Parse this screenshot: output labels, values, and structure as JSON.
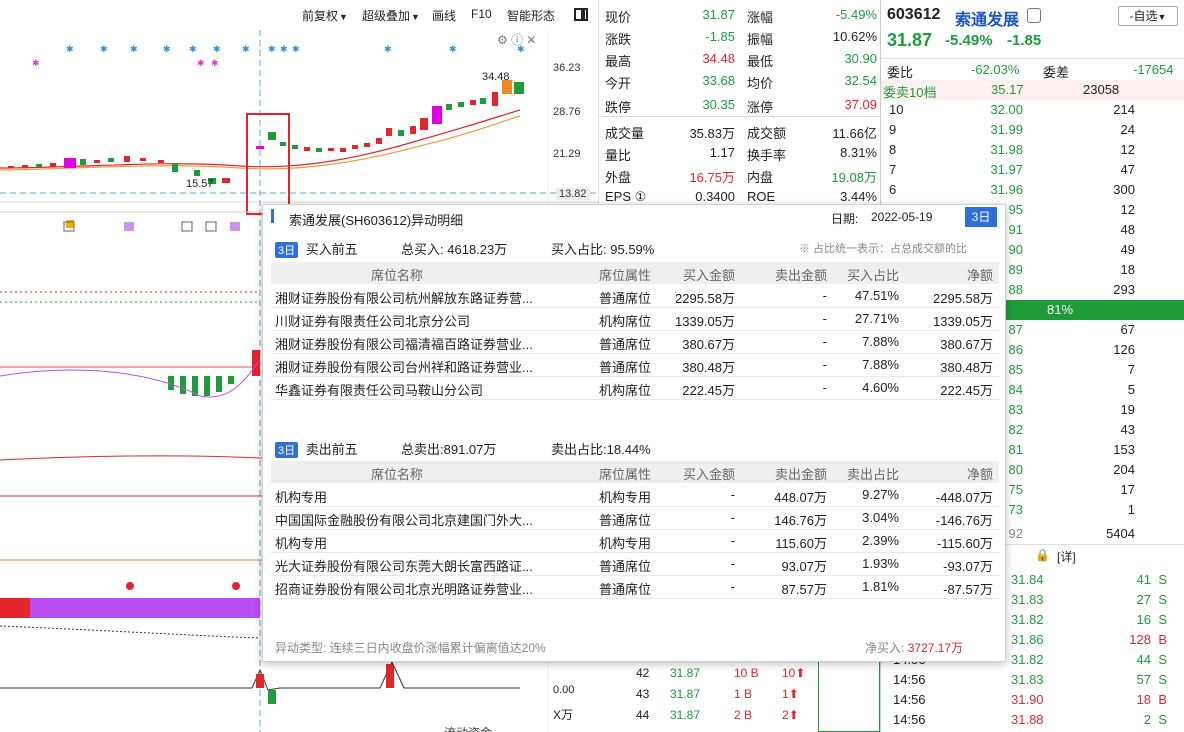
{
  "toolbar": {
    "items": [
      "前复权",
      "超级叠加",
      "画线",
      "F10",
      "智能形态"
    ]
  },
  "chart": {
    "price_ticks": [
      "36.23",
      "28.76",
      "21.29",
      "13.82"
    ],
    "high_label": "34.48",
    "low_label": "15.57",
    "lower_zero": "0.00",
    "unit_label": "X万",
    "bottom_label": "流动资金"
  },
  "quote": {
    "rows": [
      {
        "l1": "现价",
        "v1": "31.87",
        "c1": "green",
        "l2": "涨幅",
        "v2": "-5.49%",
        "c2": "green"
      },
      {
        "l1": "涨跌",
        "v1": "-1.85",
        "c1": "green",
        "l2": "振幅",
        "v2": "10.62%",
        "c2": "dark"
      },
      {
        "l1": "最高",
        "v1": "34.48",
        "c1": "red",
        "l2": "最低",
        "v2": "30.90",
        "c2": "green"
      },
      {
        "l1": "今开",
        "v1": "33.68",
        "c1": "green",
        "l2": "均价",
        "v2": "32.54",
        "c2": "green"
      },
      {
        "l1": "跌停",
        "v1": "30.35",
        "c1": "green",
        "l2": "涨停",
        "v2": "37.09",
        "c2": "red"
      },
      {
        "l1": "成交量",
        "v1": "35.83万",
        "c1": "dark",
        "l2": "成交额",
        "v2": "11.66亿",
        "c2": "dark"
      },
      {
        "l1": "量比",
        "v1": "1.17",
        "c1": "dark",
        "l2": "换手率",
        "v2": "8.31%",
        "c2": "dark"
      },
      {
        "l1": "外盘",
        "v1": "16.75万",
        "c1": "red",
        "l2": "内盘",
        "v2": "19.08万",
        "c2": "green"
      },
      {
        "l1": "EPS ①",
        "v1": "0.3400",
        "c1": "dark",
        "l2": "ROE",
        "v2": "3.44%",
        "c2": "dark"
      }
    ]
  },
  "stock": {
    "code": "603612",
    "name": "索通发展",
    "price": "31.87",
    "change_pct": "-5.49%",
    "change": "-1.85",
    "watch_button": "-自选",
    "ratio_label": "委比",
    "ratio": "-62.03%",
    "diff_label": "委差",
    "diff": "-17654",
    "sell10_label": "委卖10档",
    "sell10_price": "35.17",
    "sell10_vol": "23058"
  },
  "order_book": [
    {
      "level": "10",
      "price": "32.00",
      "vol": "214"
    },
    {
      "level": "9",
      "price": "31.99",
      "vol": "24"
    },
    {
      "level": "8",
      "price": "31.98",
      "vol": "12"
    },
    {
      "level": "7",
      "price": "31.97",
      "vol": "47"
    },
    {
      "level": "6",
      "price": "31.96",
      "vol": "300"
    },
    {
      "level": "",
      "price": "95",
      "vol": "12"
    },
    {
      "level": "",
      "price": "91",
      "vol": "48"
    },
    {
      "level": "",
      "price": "90",
      "vol": "49"
    },
    {
      "level": "",
      "price": "89",
      "vol": "18"
    },
    {
      "level": "",
      "price": "88",
      "vol": "293"
    }
  ],
  "order_bar_pct": "81%",
  "order_book_lower": [
    {
      "price": "87",
      "vol": "67"
    },
    {
      "price": "86",
      "vol": "126"
    },
    {
      "price": "85",
      "vol": "7"
    },
    {
      "price": "84",
      "vol": "5"
    },
    {
      "price": "83",
      "vol": "19"
    },
    {
      "price": "82",
      "vol": "43"
    },
    {
      "price": "81",
      "vol": "153"
    },
    {
      "price": "80",
      "vol": "204"
    },
    {
      "price": "75",
      "vol": "17"
    },
    {
      "price": "73",
      "vol": "1"
    },
    {
      "price": "92",
      "vol": "5404"
    }
  ],
  "ticks_header": "[详]",
  "ticks": [
    {
      "time": "",
      "price": "31.84",
      "vol": "41",
      "side": "S"
    },
    {
      "time": "",
      "price": "31.83",
      "vol": "27",
      "side": "S"
    },
    {
      "time": "",
      "price": "31.82",
      "vol": "16",
      "side": "S"
    },
    {
      "time": "",
      "price": "31.86",
      "vol": "128",
      "side": "B"
    },
    {
      "time": "14:56",
      "price": "31.82",
      "vol": "44",
      "side": "S"
    },
    {
      "time": "14:56",
      "price": "31.83",
      "vol": "57",
      "side": "S"
    },
    {
      "time": "14:56",
      "price": "31.90",
      "vol": "18",
      "side": "B"
    },
    {
      "time": "14:56",
      "price": "31.88",
      "vol": "2",
      "side": "S"
    }
  ],
  "mid_ticks": [
    {
      "n": "42",
      "price": "31.87",
      "v": "10 B",
      "a": "10"
    },
    {
      "n": "43",
      "price": "31.87",
      "v": "1 B",
      "a": "1"
    },
    {
      "n": "44",
      "price": "31.87",
      "v": "2 B",
      "a": "2"
    }
  ],
  "popup": {
    "title": "索通发展(SH603612)异动明细",
    "date_label": "日期:",
    "date": "2022-05-19",
    "period_button": "3日",
    "buy_tag": "3日",
    "buy_title": "买入前五",
    "buy_total_label": "总买入:",
    "buy_total": "4618.23万",
    "buy_ratio_label": "买入占比:",
    "buy_ratio": "95.59%",
    "note": "※ 占比统一表示：占总成交额的比",
    "columns": [
      "席位名称",
      "席位属性",
      "买入金额",
      "卖出金额",
      "买入占比",
      "净额"
    ],
    "buy_rows": [
      [
        "湘财证券股份有限公司杭州解放东路证券营...",
        "普通席位",
        "2295.58万",
        "-",
        "47.51%",
        "2295.58万"
      ],
      [
        "川财证券有限责任公司北京分公司",
        "机构席位",
        "1339.05万",
        "-",
        "27.71%",
        "1339.05万"
      ],
      [
        "湘财证券股份有限公司福清福百路证券营业...",
        "普通席位",
        "380.67万",
        "-",
        "7.88%",
        "380.67万"
      ],
      [
        "湘财证券股份有限公司台州祥和路证券营业...",
        "普通席位",
        "380.48万",
        "-",
        "7.88%",
        "380.48万"
      ],
      [
        "华鑫证券有限责任公司马鞍山分公司",
        "机构席位",
        "222.45万",
        "-",
        "4.60%",
        "222.45万"
      ]
    ],
    "sell_tag": "3日",
    "sell_title": "卖出前五",
    "sell_total_label": "总卖出:",
    "sell_total": "891.07万",
    "sell_ratio_label": "卖出占比:",
    "sell_ratio": "18.44%",
    "sell_columns": [
      "席位名称",
      "席位属性",
      "买入金额",
      "卖出金额",
      "卖出占比",
      "净额"
    ],
    "sell_rows": [
      [
        "机构专用",
        "机构专用",
        "-",
        "448.07万",
        "9.27%",
        "-448.07万"
      ],
      [
        "中国国际金融股份有限公司北京建国门外大...",
        "普通席位",
        "-",
        "146.76万",
        "3.04%",
        "-146.76万"
      ],
      [
        "机构专用",
        "机构专用",
        "-",
        "115.60万",
        "2.39%",
        "-115.60万"
      ],
      [
        "光大证券股份有限公司东莞大朗长富西路证...",
        "普通席位",
        "-",
        "93.07万",
        "1.93%",
        "-93.07万"
      ],
      [
        "招商证券股份有限公司北京光明路证券营业...",
        "普通席位",
        "-",
        "87.57万",
        "1.81%",
        "-87.57万"
      ]
    ],
    "footer_type": "异动类型: 连续三日内收盘价涨幅累计偏离值达20%",
    "footer_net_label": "净买入:",
    "footer_net": "3727.17万"
  },
  "colors": {
    "up": "#e4262c",
    "down": "#1e9c3a",
    "accent": "#2f6fd8",
    "purple": "#b84ef0"
  }
}
